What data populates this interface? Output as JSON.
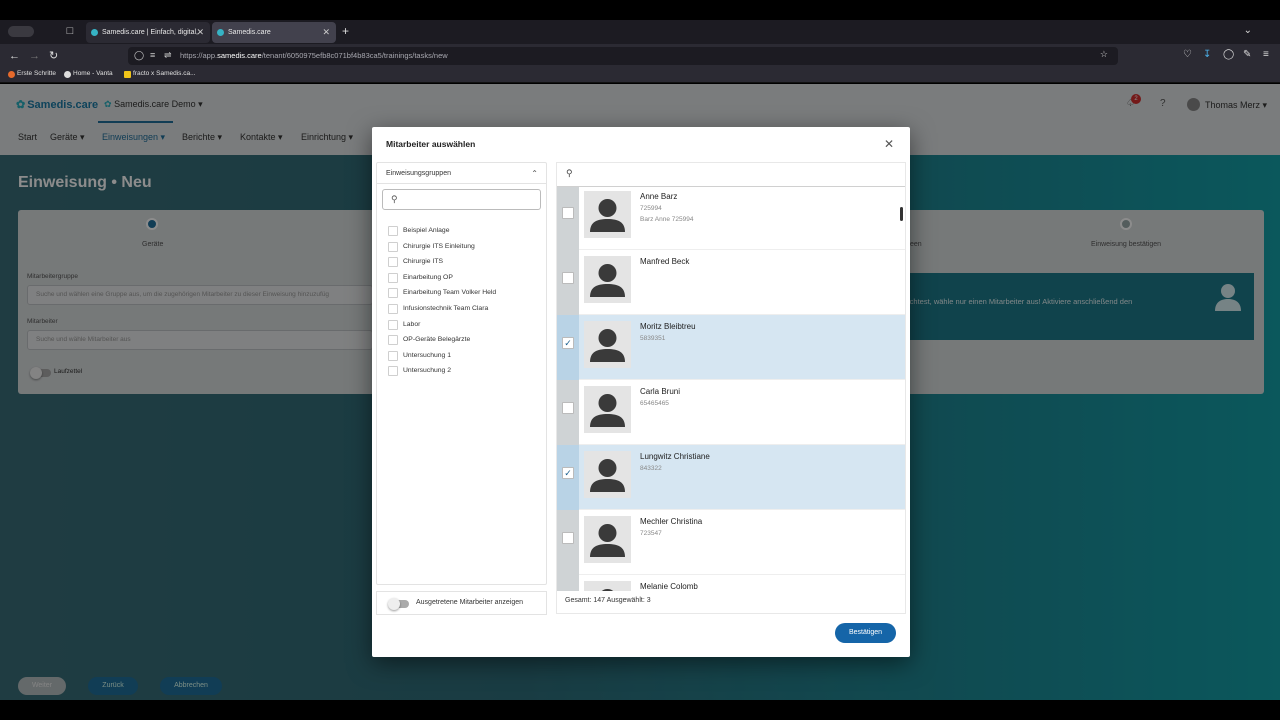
{
  "browser": {
    "tabs": [
      {
        "title": "Samedis.care | Einfach, digital, ·"
      },
      {
        "title": "Samedis.care"
      }
    ],
    "url_prefix": "https://app.",
    "url_domain": "samedis.care",
    "url_path": "/tenant/6050975efb8c071bf4b83ca5/trainings/tasks/new",
    "bookmarks": [
      "Erste Schritte",
      "Home - Vanta",
      "fracto x Samedis.ca..."
    ]
  },
  "app": {
    "logo": "Samedis.care",
    "org": "Samedis.care Demo",
    "notification_count": "2",
    "user_name": "Thomas Merz",
    "menu": [
      "Start",
      "Geräte",
      "Einweisungen",
      "Berichte",
      "Kontakte",
      "Einrichtung"
    ],
    "page_title": "Einweisung • Neu",
    "steps": [
      "Geräte",
      "een",
      "Einweisung bestätigen"
    ],
    "field1_label": "Mitarbeitergruppe",
    "field1_placeholder": "Suche und wählen eine Gruppe aus, um die zugehörigen Mitarbeiter zu dieser Einweisung hinzuzufüg",
    "field2_label": "Mitarbeiter",
    "field2_placeholder": "Suche und wähle Mitarbeiter aus",
    "laufzettel": "Laufzettel",
    "info_text": "ichtest, wähle nur einen Mitarbeiter aus! Aktiviere anschließend den",
    "bottom_buttons": [
      "Weiter",
      "Zurück",
      "Abbrechen"
    ]
  },
  "dialog": {
    "title": "Mitarbeiter auswählen",
    "groups_header": "Einweisungsgruppen",
    "groups": [
      "Beispiel Anlage",
      "Chirurgie ITS Einleitung",
      "Chirurgie ITS",
      "Einarbeitung OP",
      "Einarbeitung Team Volker Held",
      "Infusionstechnik Team Clara",
      "Labor",
      "OP-Geräte Belegärzte",
      "Untersuchung 1",
      "Untersuchung 2"
    ],
    "toggle_label": "Ausgetretene Mitarbeiter anzeigen",
    "employees": [
      {
        "name": "Anne Barz",
        "id": "725994",
        "extra": "Barz Anne 725994",
        "selected": false
      },
      {
        "name": "Manfred Beck",
        "id": "",
        "extra": "",
        "selected": false
      },
      {
        "name": "Moritz Bleibtreu",
        "id": "5839351",
        "extra": "",
        "selected": true
      },
      {
        "name": "Carla Bruni",
        "id": "65465465",
        "extra": "",
        "selected": false
      },
      {
        "name": "Lungwitz Christiane",
        "id": "843322",
        "extra": "",
        "selected": true
      },
      {
        "name": "Mechler Christina",
        "id": "723547",
        "extra": "",
        "selected": false
      },
      {
        "name": "Melanie Colomb",
        "id": "",
        "extra": "",
        "selected": false
      }
    ],
    "footer_text": "Gesamt: 147 Ausgewählt: 3",
    "confirm_label": "Bestätigen"
  },
  "colors": {
    "accent": "#1565a8",
    "selected_row": "#d6e6f2",
    "notification": "#d32f2f"
  }
}
